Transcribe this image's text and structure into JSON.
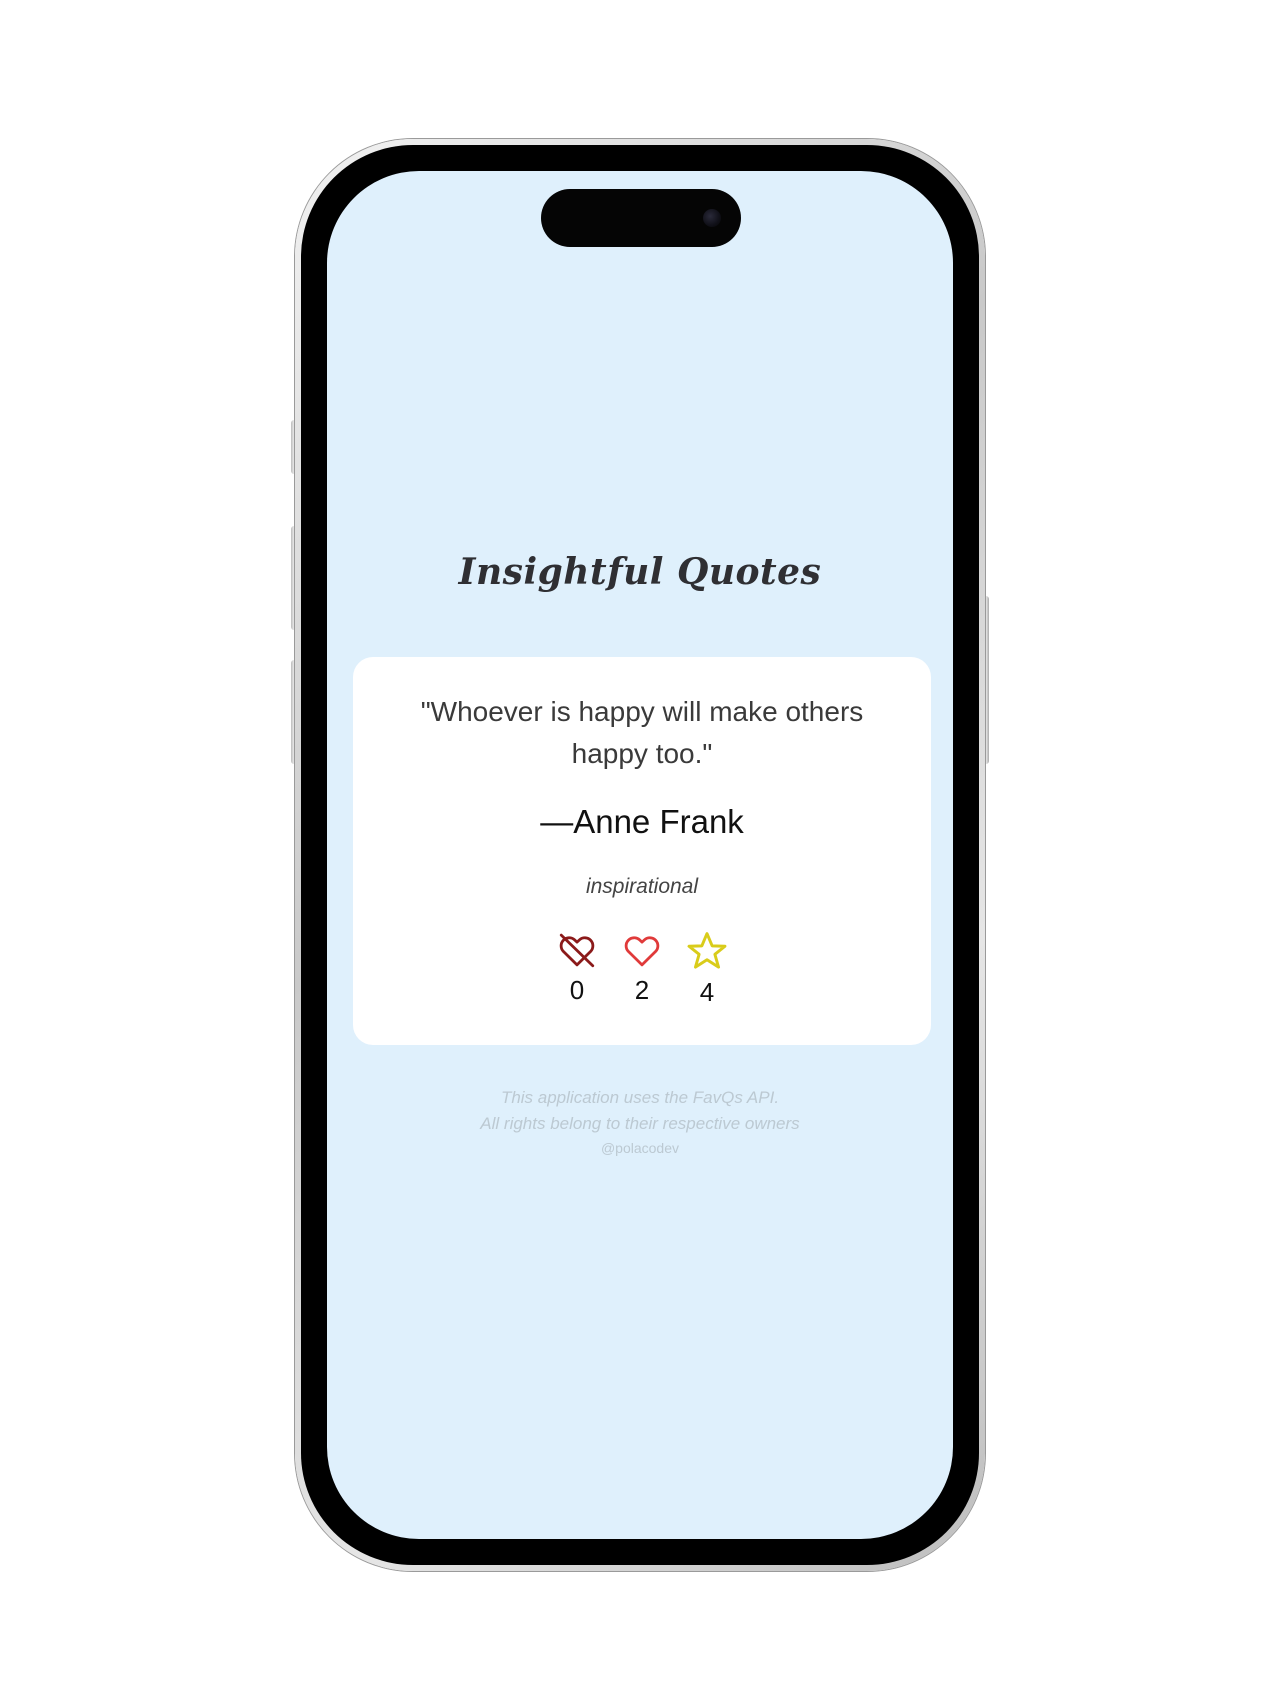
{
  "app": {
    "title": "Insightful Quotes"
  },
  "quote": {
    "text": "\"Whoever is happy will make others happy too.\"",
    "author": "—Anne Frank",
    "tag": "inspirational"
  },
  "stats": {
    "dislikes": {
      "icon": "heart-broken-icon",
      "count": "0",
      "color": "#8b1a1a"
    },
    "likes": {
      "icon": "heart-outline-icon",
      "count": "2",
      "color": "#e03a3a"
    },
    "favorites": {
      "icon": "star-outline-icon",
      "count": "4",
      "color": "#d9cc1a"
    }
  },
  "footer": {
    "api_note": "This application uses the FavQs API.",
    "rights_note": "All rights belong to their respective owners",
    "handle": "@polacodev"
  },
  "colors": {
    "screen_background": "#dff0fc",
    "card_background": "#ffffff",
    "title_color": "#2f2f33",
    "footer_color": "#bcc9d2"
  }
}
